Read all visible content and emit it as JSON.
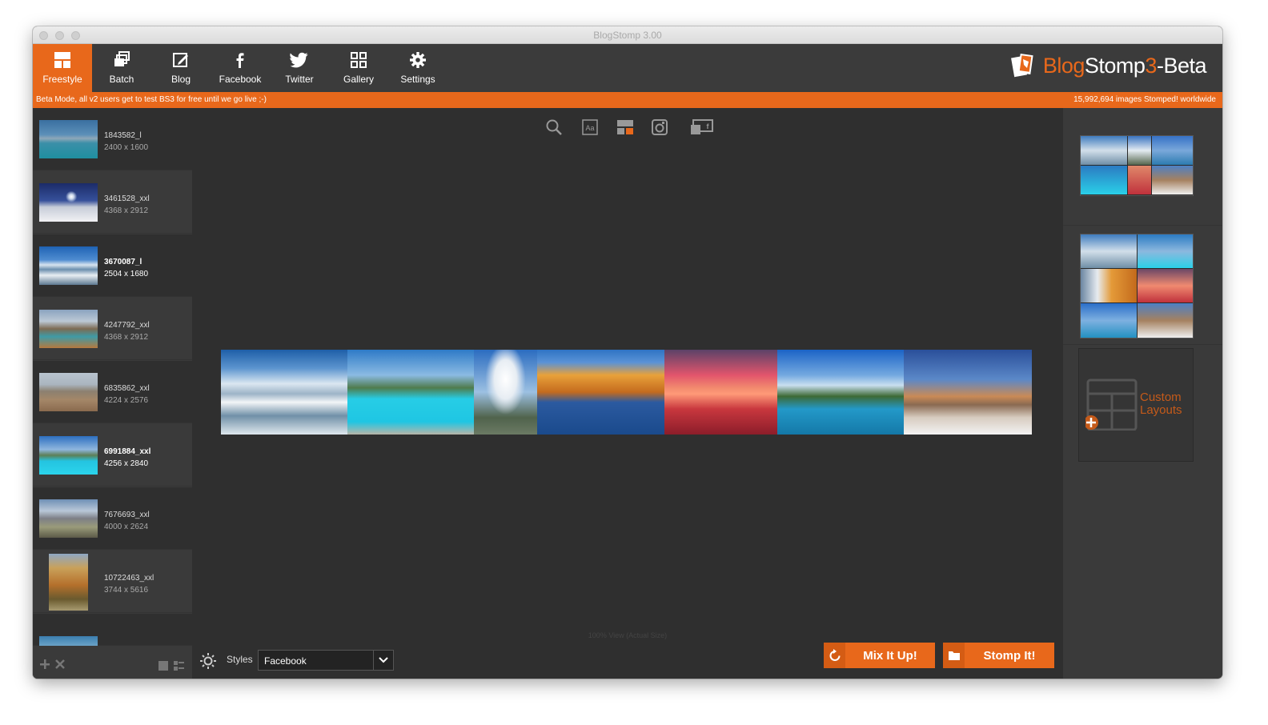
{
  "window": {
    "title": "BlogStomp 3.00"
  },
  "toolbar": {
    "items": [
      {
        "label": "Freestyle",
        "icon": "freestyle-layout-icon",
        "active": true
      },
      {
        "label": "Batch",
        "icon": "batch-stack-icon",
        "active": false
      },
      {
        "label": "Blog",
        "icon": "blog-edit-icon",
        "active": false
      },
      {
        "label": "Facebook",
        "icon": "facebook-icon",
        "active": false
      },
      {
        "label": "Twitter",
        "icon": "twitter-bird-icon",
        "active": false
      },
      {
        "label": "Gallery",
        "icon": "gallery-grid-icon",
        "active": false
      },
      {
        "label": "Settings",
        "icon": "gear-icon",
        "active": false
      }
    ]
  },
  "logo": {
    "part1": "Blog",
    "part2": "Stomp",
    "part3": "3",
    "part4": "-Beta"
  },
  "banner": {
    "left": "Beta Mode, all v2 users get to test BS3 for free until we go live ;-)",
    "right": "15,992,694 images Stomped! worldwide"
  },
  "images": [
    {
      "name": "1843582_l",
      "dims": "2400 x 1600"
    },
    {
      "name": "3461528_xxl",
      "dims": "4368 x 2912"
    },
    {
      "name": "3670087_l",
      "dims": "2504 x 1680"
    },
    {
      "name": "4247792_xxl",
      "dims": "4368 x 2912"
    },
    {
      "name": "6835862_xxl",
      "dims": "4224 x 2576"
    },
    {
      "name": "6991884_xxl",
      "dims": "4256 x 2840"
    },
    {
      "name": "7676693_xxl",
      "dims": "4000 x 2624"
    },
    {
      "name": "10722463_xxl",
      "dims": "3744 x 5616"
    }
  ],
  "canvas": {
    "tools": [
      "search-icon",
      "text-icon",
      "layout-icon",
      "instagram-icon",
      "facebook-preview-icon"
    ],
    "view_hint": "100% View (Actual Size)"
  },
  "bottom_bar": {
    "styles_label": "Styles",
    "styles_value": "Facebook",
    "mix_label": "Mix It Up!",
    "stomp_label": "Stomp It!"
  },
  "layouts": {
    "custom_line1": "Custom",
    "custom_line2": "Layouts"
  },
  "colors": {
    "accent": "#e8681b",
    "background": "#2f2f2f",
    "panel": "#3a3a3a"
  }
}
